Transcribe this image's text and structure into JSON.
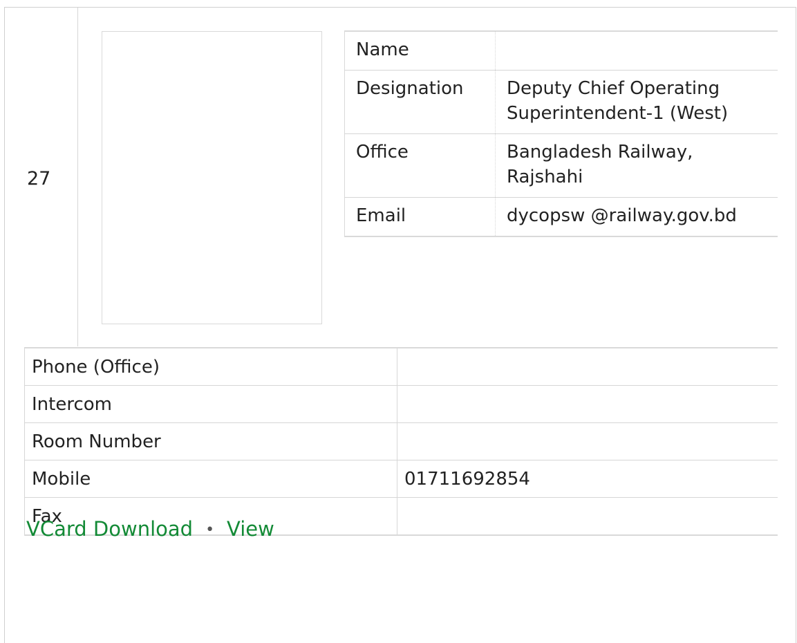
{
  "entry": {
    "serial": "27",
    "info": [
      {
        "label": "Name",
        "value": ""
      },
      {
        "label": "Designation",
        "value": "Deputy Chief Operating Superintendent-1 (West)"
      },
      {
        "label": "Office",
        "value": "Bangladesh Railway, Rajshahi"
      },
      {
        "label": "Email",
        "value": "dycopsw @railway.gov.bd"
      }
    ],
    "contact": [
      {
        "label": "Phone (Office)",
        "value": ""
      },
      {
        "label": "Intercom",
        "value": ""
      },
      {
        "label": "Room Number",
        "value": ""
      },
      {
        "label": "Mobile",
        "value": "01711692854"
      },
      {
        "label": "Fax",
        "value": ""
      }
    ],
    "links": {
      "vcard_label": "VCard Download",
      "separator": "•",
      "view_label": "View"
    },
    "colors": {
      "link": "#138a36",
      "border": "#d6d6d6"
    }
  }
}
